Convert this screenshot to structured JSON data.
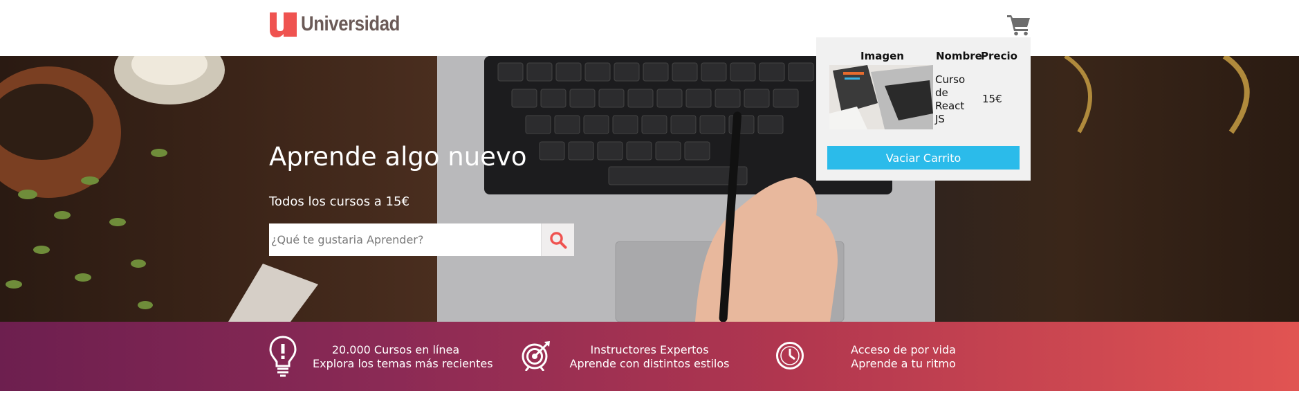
{
  "brand": {
    "name": "Universidad",
    "accent": "#ef5350"
  },
  "hero": {
    "title": "Aprende algo nuevo",
    "subtitle": "Todos los cursos a 15€",
    "search_placeholder": "¿Qué te gustaria Aprender?"
  },
  "cart": {
    "headers": [
      "Imagen",
      "Nombre",
      "Precio"
    ],
    "items": [
      {
        "name": "Curso de React JS",
        "price": "15€"
      }
    ],
    "empty_label": "Vaciar Carrito"
  },
  "features": [
    {
      "icon": "lightbulb-icon",
      "line1": "20.000 Cursos en línea",
      "line2": "Explora los temas más recientes"
    },
    {
      "icon": "target-icon",
      "line1": "Instructores Expertos",
      "line2": "Aprende con distintos estilos"
    },
    {
      "icon": "clock-icon",
      "line1": "Acceso de por vida",
      "line2": "Aprende a tu ritmo"
    }
  ],
  "colors": {
    "button": "#2bbbea",
    "cart_panel": "#f1f1f1",
    "band_start": "#6d1f4f",
    "band_end": "#e15452"
  }
}
